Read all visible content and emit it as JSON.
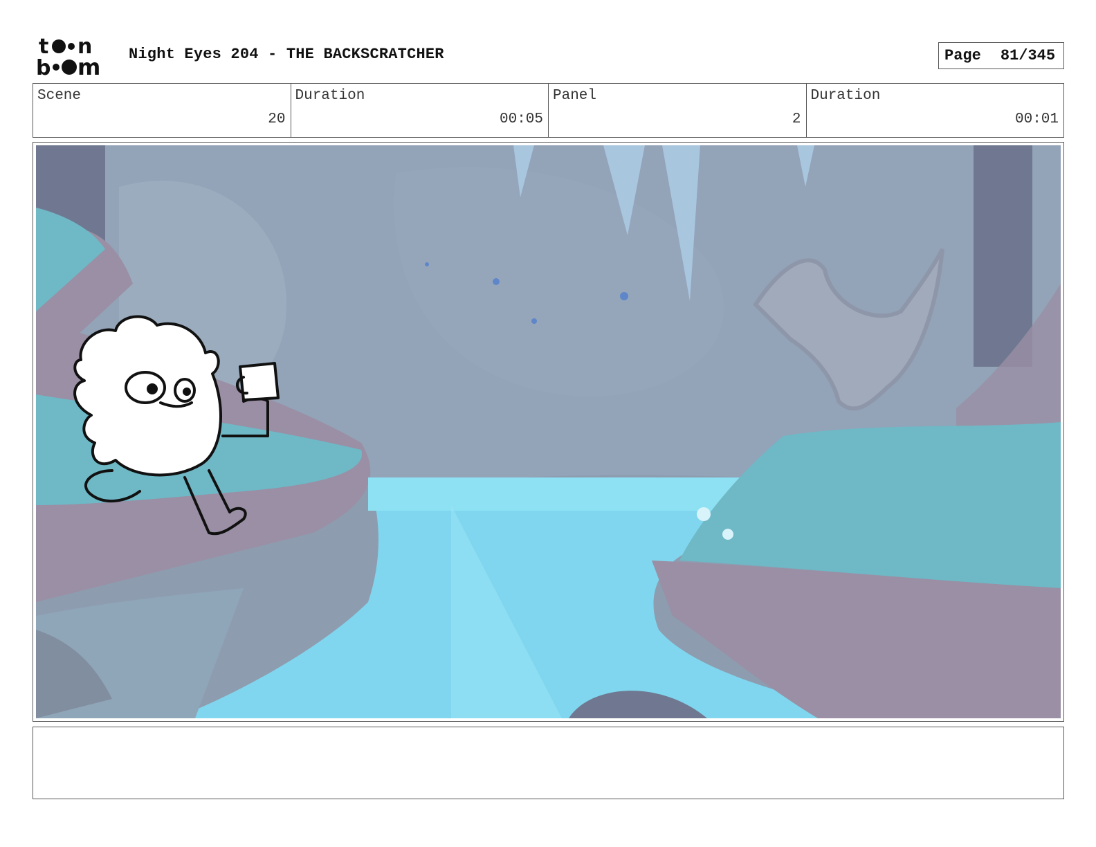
{
  "header": {
    "logo_alt": "toon boom",
    "title": "Night Eyes 204 - THE BACKSCRATCHER",
    "page_label": "Page",
    "page_number": "81/345"
  },
  "info": {
    "scene_label": "Scene",
    "scene_value": "20",
    "scene_duration_label": "Duration",
    "scene_duration_value": "00:05",
    "panel_label": "Panel",
    "panel_value": "2",
    "panel_duration_label": "Duration",
    "panel_duration_value": "00:01"
  },
  "notes": {
    "text": ""
  },
  "colors": {
    "backdrop": "#8e9cb0",
    "water": "#7fd6ee",
    "grass": "#6fb8c6",
    "rock": "#9a8fa4"
  }
}
